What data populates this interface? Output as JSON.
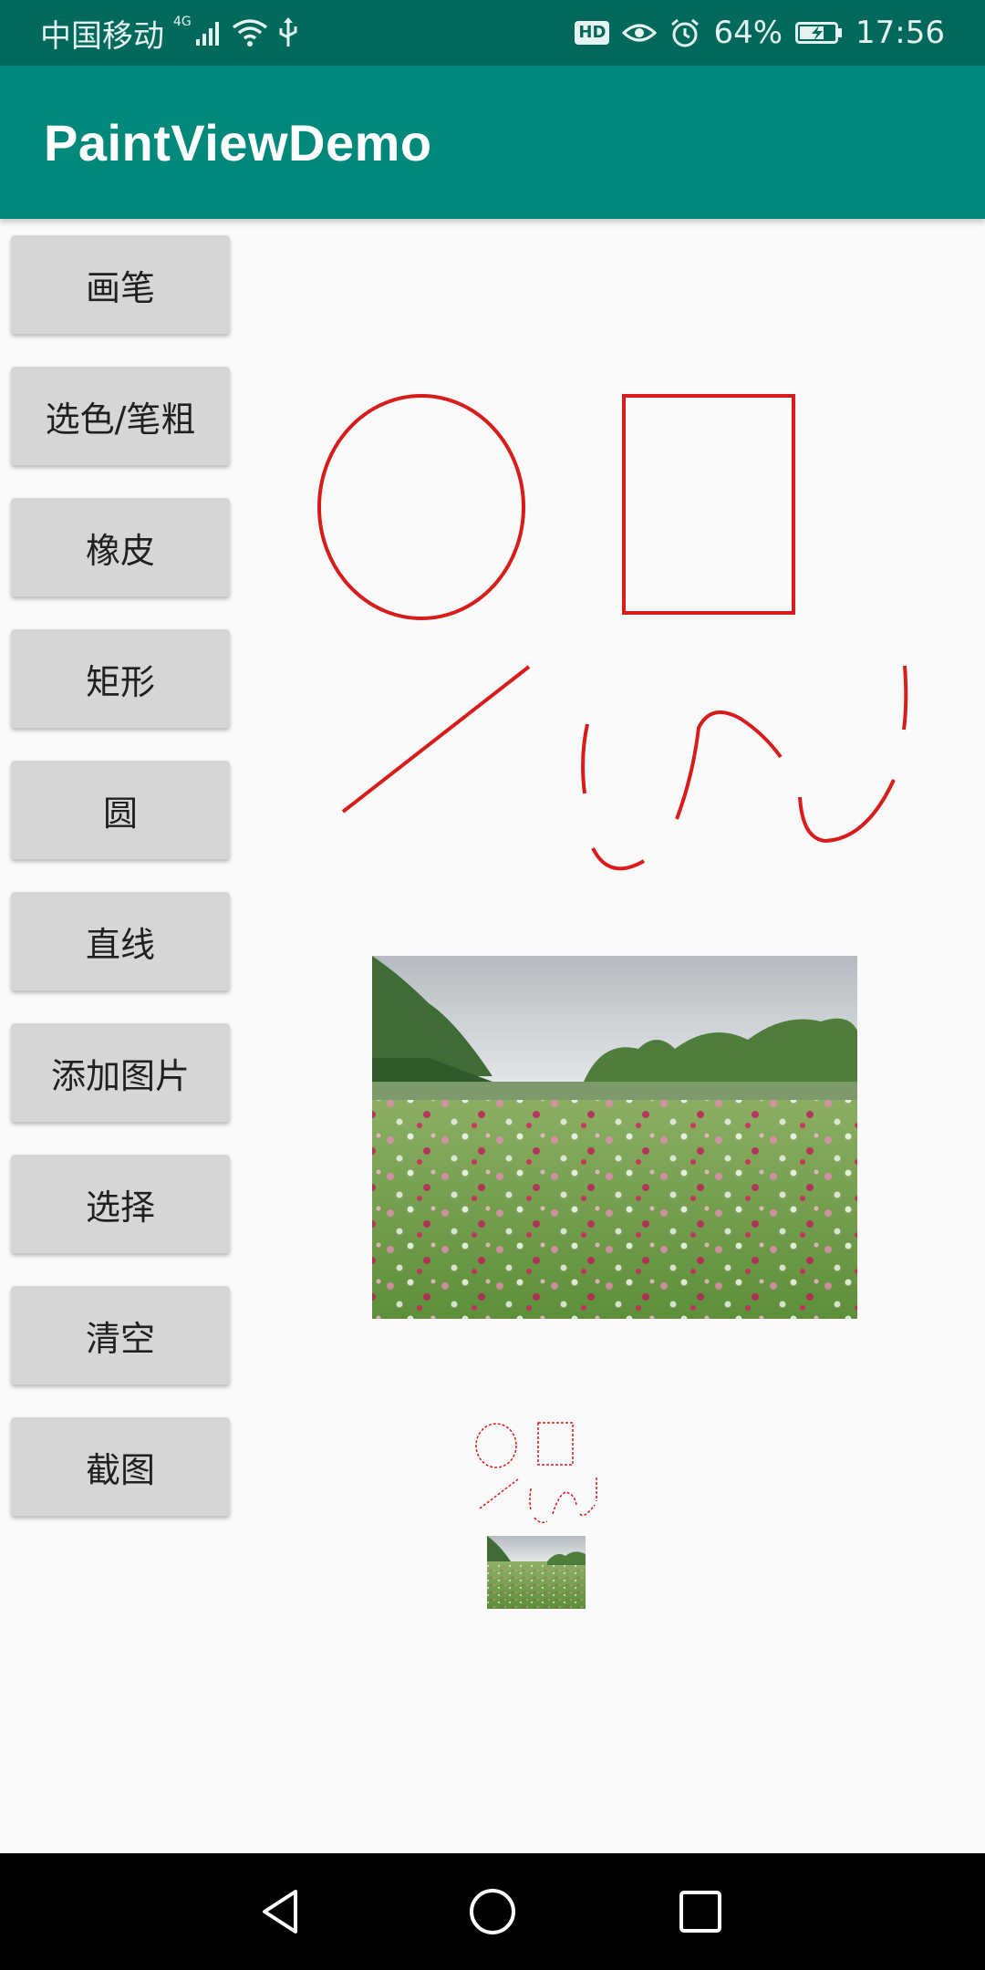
{
  "status_bar": {
    "carrier": "中国移动",
    "network": "4G",
    "battery_percent": "64%",
    "time": "17:56",
    "hd_label": "HD"
  },
  "app_bar": {
    "title": "PaintViewDemo"
  },
  "tools": [
    {
      "label": "画笔"
    },
    {
      "label": "选色/笔粗"
    },
    {
      "label": "橡皮"
    },
    {
      "label": "矩形"
    },
    {
      "label": "圆"
    },
    {
      "label": "直线"
    },
    {
      "label": "添加图片"
    },
    {
      "label": "选择"
    },
    {
      "label": "清空"
    },
    {
      "label": "截图"
    }
  ],
  "canvas": {
    "stroke_color": "#d81b1b",
    "image_subject": "flower field landscape photo"
  },
  "colors": {
    "status_bar": "#00695c",
    "app_bar": "#00897b",
    "button": "#d6d6d6",
    "background": "#fafafa"
  },
  "nav_bar": {
    "back_icon": "back-triangle-icon",
    "home_icon": "home-circle-icon",
    "recents_icon": "recents-square-icon"
  }
}
